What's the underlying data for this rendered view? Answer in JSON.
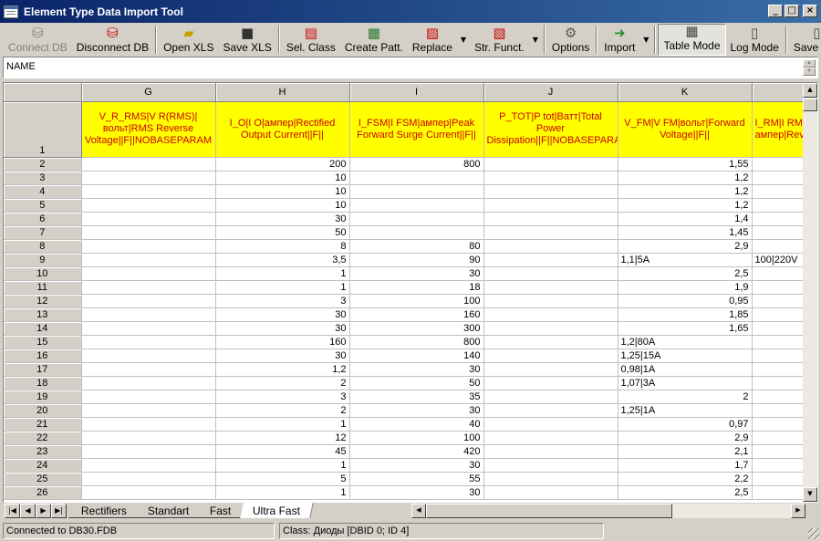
{
  "window": {
    "title": "Element Type Data Import Tool",
    "minimize_label": "_",
    "maximize_label": "□",
    "close_label": "×"
  },
  "toolbar": {
    "connect_db": "Connect DB",
    "disconnect_db": "Disconnect DB",
    "open_xls": "Open XLS",
    "save_xls": "Save XLS",
    "sel_class": "Sel. Class",
    "create_patt": "Create Patt.",
    "replace": "Replace",
    "str_funct": "Str. Funct.",
    "options": "Options",
    "import": "Import",
    "table_mode": "Table Mode",
    "log_mode": "Log Mode",
    "save_log": "Save Log"
  },
  "namebar": {
    "value": "NAME"
  },
  "grid": {
    "columns": [
      "G",
      "H",
      "I",
      "J",
      "K",
      ""
    ],
    "header_row_num": "1",
    "header_cells": [
      "V_R_RMS|V R(RMS)|вольт|RMS Reverse Voltage||F||NOBASEPARAM",
      "I_O|I O|ампер|Rectified Output Current||F||",
      "I_FSM|I FSM|ампер|Peak Forward Surge Current||F||",
      "P_TOT|P tot|Ватт|Total Power Dissipation||F||NOBASEPARAM",
      "V_FM|V FM|вольт|Forward Voltage||F||",
      "I_RM|I RM|ампер|Reverse"
    ],
    "rows": [
      {
        "n": "2",
        "g": "",
        "h": "200",
        "i": "800",
        "j": "",
        "k": "1,55",
        "l": ""
      },
      {
        "n": "3",
        "g": "",
        "h": "10",
        "i": "",
        "j": "",
        "k": "1,2",
        "l": ""
      },
      {
        "n": "4",
        "g": "",
        "h": "10",
        "i": "",
        "j": "",
        "k": "1,2",
        "l": ""
      },
      {
        "n": "5",
        "g": "",
        "h": "10",
        "i": "",
        "j": "",
        "k": "1,2",
        "l": ""
      },
      {
        "n": "6",
        "g": "",
        "h": "30",
        "i": "",
        "j": "",
        "k": "1,4",
        "l": ""
      },
      {
        "n": "7",
        "g": "",
        "h": "50",
        "i": "",
        "j": "",
        "k": "1,45",
        "l": ""
      },
      {
        "n": "8",
        "g": "",
        "h": "8",
        "i": "80",
        "j": "",
        "k": "2,9",
        "l": ""
      },
      {
        "n": "9",
        "g": "",
        "h": "3,5",
        "i": "90",
        "j": "",
        "k": "1,1|5A",
        "kt": true,
        "l": "100|220V"
      },
      {
        "n": "10",
        "g": "",
        "h": "1",
        "i": "30",
        "j": "",
        "k": "2,5",
        "l": ""
      },
      {
        "n": "11",
        "g": "",
        "h": "1",
        "i": "18",
        "j": "",
        "k": "1,9",
        "l": ""
      },
      {
        "n": "12",
        "g": "",
        "h": "3",
        "i": "100",
        "j": "",
        "k": "0,95",
        "l": ""
      },
      {
        "n": "13",
        "g": "",
        "h": "30",
        "i": "160",
        "j": "",
        "k": "1,85",
        "l": ""
      },
      {
        "n": "14",
        "g": "",
        "h": "30",
        "i": "300",
        "j": "",
        "k": "1,65",
        "l": ""
      },
      {
        "n": "15",
        "g": "",
        "h": "160",
        "i": "800",
        "j": "",
        "k": "1,2|80A",
        "kt": true,
        "l": ""
      },
      {
        "n": "16",
        "g": "",
        "h": "30",
        "i": "140",
        "j": "",
        "k": "1,25|15A",
        "kt": true,
        "l": ""
      },
      {
        "n": "17",
        "g": "",
        "h": "1,2",
        "i": "30",
        "j": "",
        "k": "0,98|1A",
        "kt": true,
        "l": ""
      },
      {
        "n": "18",
        "g": "",
        "h": "2",
        "i": "50",
        "j": "",
        "k": "1,07|3A",
        "kt": true,
        "l": ""
      },
      {
        "n": "19",
        "g": "",
        "h": "3",
        "i": "35",
        "j": "",
        "k": "2",
        "l": ""
      },
      {
        "n": "20",
        "g": "",
        "h": "2",
        "i": "30",
        "j": "",
        "k": "1,25|1A",
        "kt": true,
        "l": ""
      },
      {
        "n": "21",
        "g": "",
        "h": "1",
        "i": "40",
        "j": "",
        "k": "0,97",
        "l": ""
      },
      {
        "n": "22",
        "g": "",
        "h": "12",
        "i": "100",
        "j": "",
        "k": "2,9",
        "l": ""
      },
      {
        "n": "23",
        "g": "",
        "h": "45",
        "i": "420",
        "j": "",
        "k": "2,1",
        "l": ""
      },
      {
        "n": "24",
        "g": "",
        "h": "1",
        "i": "30",
        "j": "",
        "k": "1,7",
        "l": ""
      },
      {
        "n": "25",
        "g": "",
        "h": "5",
        "i": "55",
        "j": "",
        "k": "2,2",
        "l": ""
      },
      {
        "n": "26",
        "g": "",
        "h": "1",
        "i": "30",
        "j": "",
        "k": "2,5",
        "l": ""
      }
    ]
  },
  "sheets": {
    "tabs": [
      "Rectifiers",
      "Standart",
      "Fast",
      "Ultra Fast"
    ],
    "active": "Ultra Fast"
  },
  "status": {
    "connection": "Connected to DB30.FDB",
    "class_info": "Class: Диоды [DBID 0; ID 4]"
  }
}
